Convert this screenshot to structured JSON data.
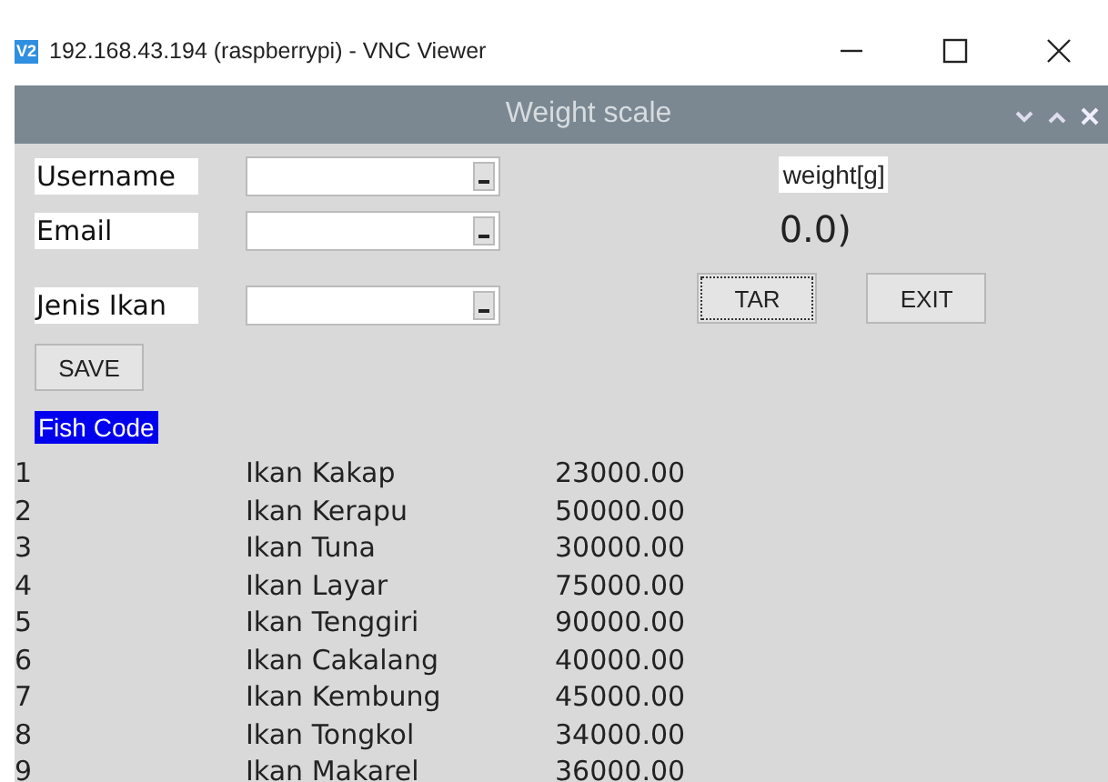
{
  "viewer": {
    "logo": "V2",
    "title": "192.168.43.194 (raspberrypi) - VNC Viewer"
  },
  "window": {
    "title": "Weight scale"
  },
  "form": [
    {
      "label": "Username"
    },
    {
      "label": "Email"
    },
    {
      "label": "Jenis Ikan"
    }
  ],
  "save_button": "SAVE",
  "weight": {
    "label": "weight[g]",
    "reading": "0.0)"
  },
  "buttons": [
    {
      "label": "TAR",
      "focused": true
    },
    {
      "label": "EXIT",
      "focused": false
    }
  ],
  "list": {
    "heading": "Fish Code",
    "rows": [
      [
        "1",
        "Ikan Kakap",
        "23000.00"
      ],
      [
        "2",
        "Ikan Kerapu",
        "50000.00"
      ],
      [
        "3",
        "Ikan Tuna",
        "30000.00"
      ],
      [
        "4",
        "Ikan Layar",
        "75000.00"
      ],
      [
        "5",
        "Ikan Tenggiri",
        "90000.00"
      ],
      [
        "6",
        "Ikan Cakalang",
        "40000.00"
      ],
      [
        "7",
        "Ikan Kembung",
        "45000.00"
      ],
      [
        "8",
        "Ikan Tongkol",
        "34000.00"
      ],
      [
        "9",
        "Ikan Makarel",
        "36000.00"
      ]
    ]
  }
}
